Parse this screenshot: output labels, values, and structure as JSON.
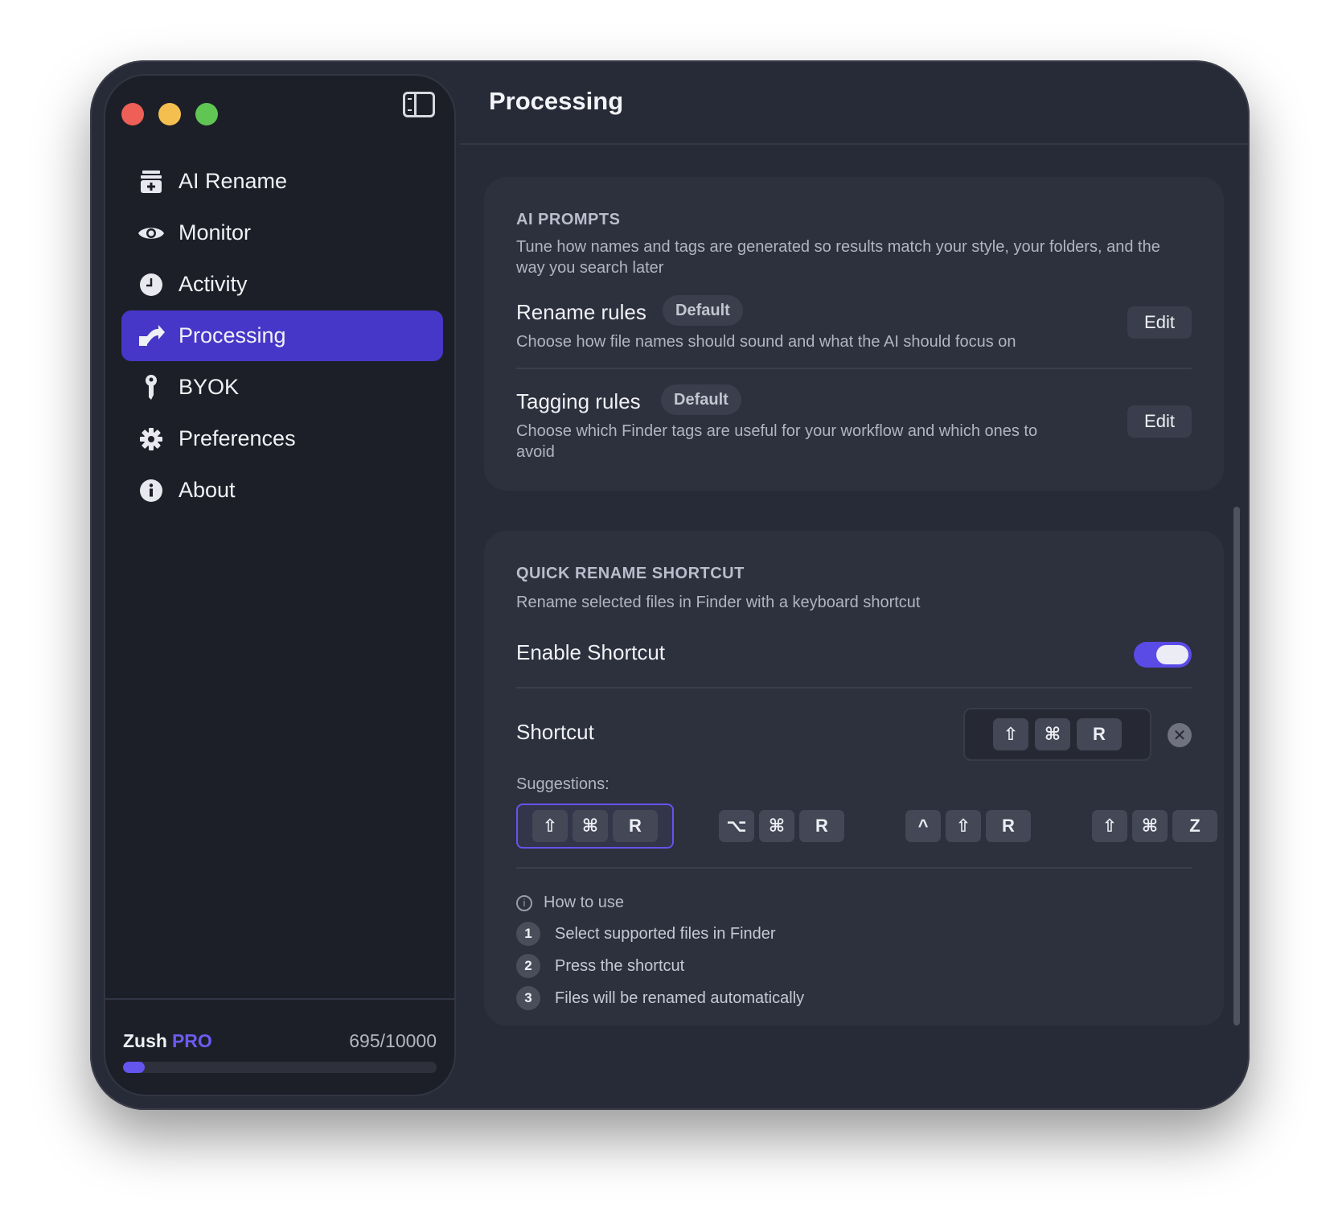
{
  "sidebar": {
    "items": [
      {
        "label": "AI Rename",
        "icon": "ai-rename-icon",
        "active": false
      },
      {
        "label": "Monitor",
        "icon": "eye-icon",
        "active": false
      },
      {
        "label": "Activity",
        "icon": "clock-icon",
        "active": false
      },
      {
        "label": "Processing",
        "icon": "processing-icon",
        "active": true
      },
      {
        "label": "BYOK",
        "icon": "key-icon",
        "active": false
      },
      {
        "label": "Preferences",
        "icon": "gear-icon",
        "active": false
      },
      {
        "label": "About",
        "icon": "info-icon",
        "active": false
      }
    ],
    "footer": {
      "app_name": "Zush",
      "plan": "PRO",
      "usage": "695/10000",
      "progress_fraction": 0.0695
    }
  },
  "header": {
    "title": "Processing"
  },
  "ai_prompts": {
    "title": "AI PROMPTS",
    "description": "Tune how names and tags are generated so results match your style, your folders, and the way you search later",
    "rename_rules": {
      "title": "Rename rules",
      "badge": "Default",
      "description": "Choose how file names should sound and what the AI should focus on",
      "button": "Edit"
    },
    "tagging_rules": {
      "title": "Tagging rules",
      "badge": "Default",
      "description": "Choose which Finder tags are useful for your workflow and which ones to avoid",
      "button": "Edit"
    }
  },
  "quick_rename": {
    "title": "QUICK RENAME SHORTCUT",
    "description": "Rename selected files in Finder with a keyboard shortcut",
    "enable_label": "Enable Shortcut",
    "enabled": true,
    "shortcut_label": "Shortcut",
    "shortcut_keys": [
      "⇧",
      "⌘",
      "R"
    ],
    "clear_glyph": "✕",
    "suggestions_label": "Suggestions:",
    "suggestions": [
      {
        "keys": [
          "⇧",
          "⌘",
          "R"
        ],
        "selected": true
      },
      {
        "keys": [
          "⌥",
          "⌘",
          "R"
        ],
        "selected": false
      },
      {
        "keys": [
          "^",
          "⇧",
          "R"
        ],
        "selected": false
      },
      {
        "keys": [
          "⇧",
          "⌘",
          "Z"
        ],
        "selected": false
      }
    ],
    "how_to_use": {
      "title": "How to use",
      "info_glyph": "i",
      "steps": [
        {
          "num": "1",
          "text": "Select supported files in Finder"
        },
        {
          "num": "2",
          "text": "Press the shortcut"
        },
        {
          "num": "3",
          "text": "Files will be renamed automatically"
        }
      ]
    }
  },
  "colors": {
    "accent": "#4737c9",
    "toggle_on": "#5a4ae6",
    "pro": "#6b5cf0"
  }
}
